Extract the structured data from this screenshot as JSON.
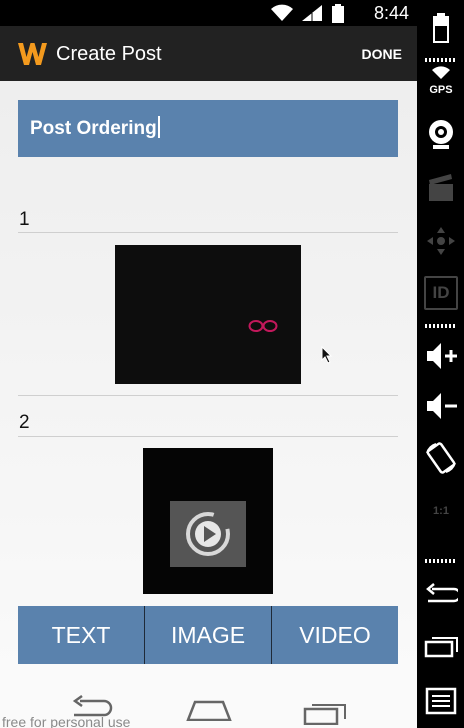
{
  "status_bar": {
    "time": "8:44"
  },
  "action_bar": {
    "title": "Create Post",
    "done_label": "DONE"
  },
  "post": {
    "title_value": "Post Ordering",
    "items": [
      {
        "number": "1"
      },
      {
        "number": "2"
      }
    ]
  },
  "add_buttons": {
    "text_label": "TEXT",
    "image_label": "IMAGE",
    "video_label": "VIDEO"
  },
  "nav_bar": {
    "watermark": "free for personal use"
  },
  "emulator_toolbar": {
    "gps_label": "GPS",
    "id_label": "ID",
    "scale_label": "1:1"
  },
  "colors": {
    "accent": "#5a82ad",
    "action_bar": "#222222",
    "logo": "#f39a1e",
    "eyes": "#c2185b"
  }
}
